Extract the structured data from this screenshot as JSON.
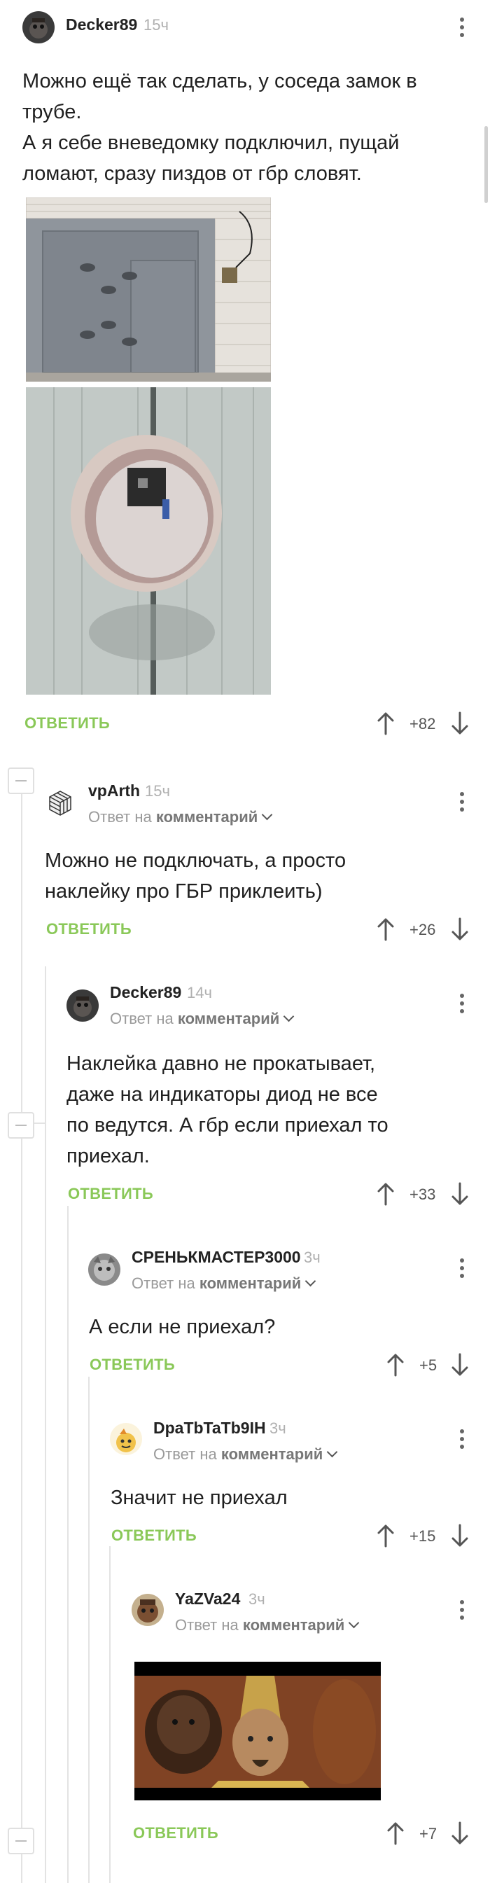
{
  "comments": [
    {
      "user": "Decker89",
      "time": "15ч",
      "text_lines": [
        "Можно ещё так сделать,  у соседа замок в",
        "трубе.",
        "А я себе вневедомку подключил, пущай",
        "ломают, сразу пиздов от гбр словят."
      ],
      "rating": "+82",
      "reply_label": "ОТВЕТИТЬ"
    },
    {
      "user": "vpArth",
      "time": "15ч",
      "reply_to_prefix": "Ответ на",
      "reply_to_target": "комментарий",
      "text_lines": [
        "Можно не подключать, а просто",
        "наклейку про ГБР приклеить)"
      ],
      "rating": "+26",
      "reply_label": "ОТВЕТИТЬ"
    },
    {
      "user": "Decker89",
      "time": "14ч",
      "reply_to_prefix": "Ответ на",
      "reply_to_target": "комментарий",
      "text_lines": [
        "Наклейка давно не прокатывает,",
        "даже на индикаторы диод не все",
        "по ведутся. А гбр если приехал то",
        "приехал."
      ],
      "rating": "+33",
      "reply_label": "ОТВЕТИТЬ"
    },
    {
      "user": "СРЕНЬКМАСТЕР3000",
      "time": "3ч",
      "reply_to_prefix": "Ответ на",
      "reply_to_target": "комментарий",
      "text_lines": [
        "А если не приехал?"
      ],
      "rating": "+5",
      "reply_label": "ОТВЕТИТЬ"
    },
    {
      "user": "DpaTbTaTb9IH",
      "time": "3ч",
      "reply_to_prefix": "Ответ на",
      "reply_to_target": "комментарий",
      "text_lines": [
        "Значит не приехал"
      ],
      "rating": "+15",
      "reply_label": "ОТВЕТИТЬ"
    },
    {
      "user": "YaZVa24",
      "time": "3ч",
      "reply_to_prefix": "Ответ на",
      "reply_to_target": "комментарий",
      "rating": "+7",
      "reply_label": "ОТВЕТИТЬ"
    }
  ],
  "icons": {
    "upvote": "arrow-up-icon",
    "downvote": "arrow-down-icon",
    "more": "more-vertical-icon",
    "collapse": "collapse-minus-icon",
    "reply_chevron": "chevron-down-icon"
  },
  "colors": {
    "reply_accent": "#8ac858",
    "thread_line": "#e3e3e3",
    "muted_text": "#9a9a9a"
  }
}
